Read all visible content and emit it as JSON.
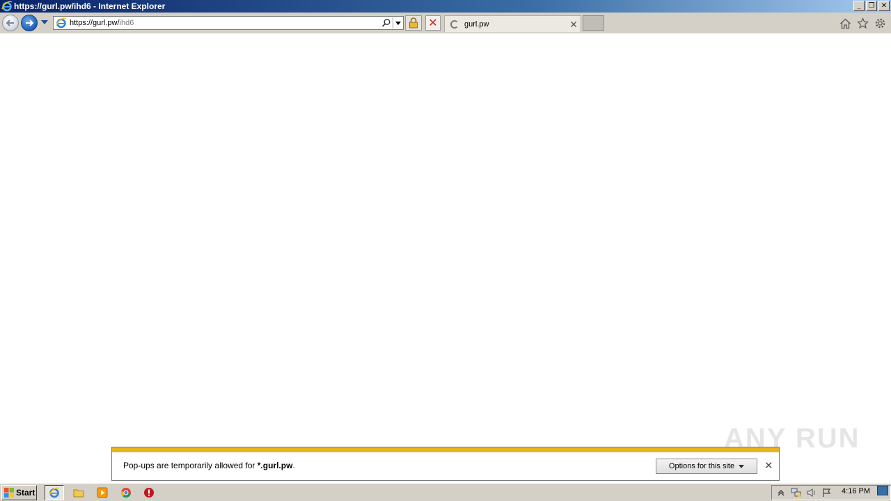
{
  "window": {
    "title": "https://gurl.pw/ihd6 - Internet Explorer",
    "controls": {
      "minimize": "_",
      "restore": "❐",
      "close": "✕"
    }
  },
  "toolbar": {
    "address_prefix": "https://gurl.pw/",
    "address_path": "ihd6",
    "stop_glyph": "✕",
    "tab": {
      "label": "gurl.pw",
      "close": "✕"
    }
  },
  "notification": {
    "message_start": "Pop-ups are temporarily allowed for ",
    "message_site": "*.gurl.pw",
    "message_end": ".",
    "options_label": "Options for this site",
    "close": "✕",
    "accent_color": "#e9b31b"
  },
  "watermark": "ANY RUN",
  "taskbar": {
    "start_label": "Start",
    "clock": "4:16 PM"
  },
  "icons": [
    "ie-icon",
    "home-icon",
    "star-icon",
    "gear-icon",
    "search-icon",
    "lock-icon",
    "folder-icon",
    "media-player-icon",
    "chrome-icon",
    "stop-sign-icon",
    "flag-icon",
    "volume-icon",
    "network-icon"
  ]
}
